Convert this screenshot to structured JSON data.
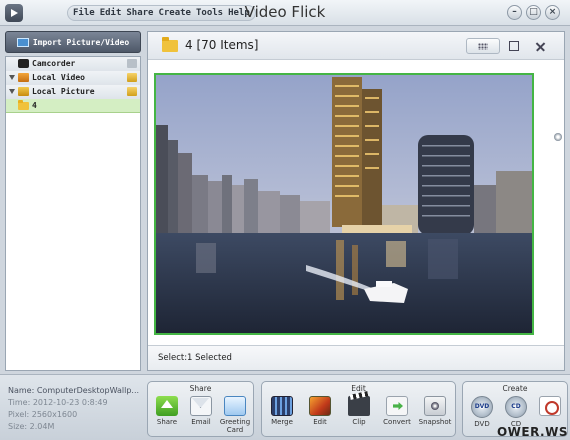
{
  "app": {
    "title": "Video Flick",
    "menu": [
      "File",
      "Edit",
      "Share",
      "Create",
      "Tools",
      "Help"
    ],
    "window_buttons": [
      "minimize",
      "maximize",
      "close"
    ]
  },
  "sidebar": {
    "import_label": "Import Picture/Video",
    "items": [
      {
        "label": "Camcorder",
        "icon": "camcorder-icon"
      },
      {
        "label": "Local Video",
        "icon": "video-folder-icon"
      },
      {
        "label": "Local Picture",
        "icon": "picture-folder-icon"
      },
      {
        "label": "4",
        "icon": "folder-icon"
      }
    ]
  },
  "main": {
    "folder_title": "4 [70 Items]",
    "select_label": "Select:",
    "select_value": "1 Selected"
  },
  "info": {
    "name": "Name: ComputerDesktopWallp...",
    "time": "Time: 2012-10-23 0:8:49",
    "pixel": "Pixel: 2560x1600",
    "size": "Size: 2.04M"
  },
  "toolbar": {
    "share": {
      "title": "Share",
      "tools": [
        "Share",
        "Email",
        "Greeting\nCard"
      ]
    },
    "edit": {
      "title": "Edit",
      "tools": [
        "Merge",
        "Edit",
        "Clip",
        "Convert",
        "Snapshot"
      ]
    },
    "create": {
      "title": "Create",
      "tools": [
        "DVD",
        "CD",
        ""
      ],
      "dvd_badge": "DVD",
      "cd_badge": "CD"
    }
  },
  "watermark": "OWER.WS"
}
